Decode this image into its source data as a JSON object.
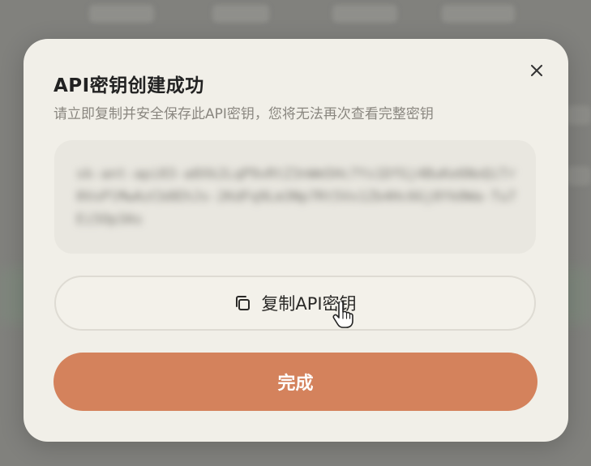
{
  "dialog": {
    "title": "API密钥创建成功",
    "subtitle": "请立即复制并安全保存此API密钥，您将无法再次查看完整密钥",
    "close_icon": "close-icon",
    "api_key_masked": "sk-ant-api03-a8Xk2LqP9vRtZ3nWm5Hc7Ys1DfGj4BuKe6NoQiTr0VxPlMwAzCb8EhJs-2KdFq9Lm3Np7Rt5Vx1Zb4Hc6Gj8Yk0Wa-Tu7Ei5Op3As",
    "copy_button_label": "复制API密钥",
    "copy_icon": "copy-icon",
    "done_button_label": "完成",
    "accent_color": "#d4825c"
  }
}
